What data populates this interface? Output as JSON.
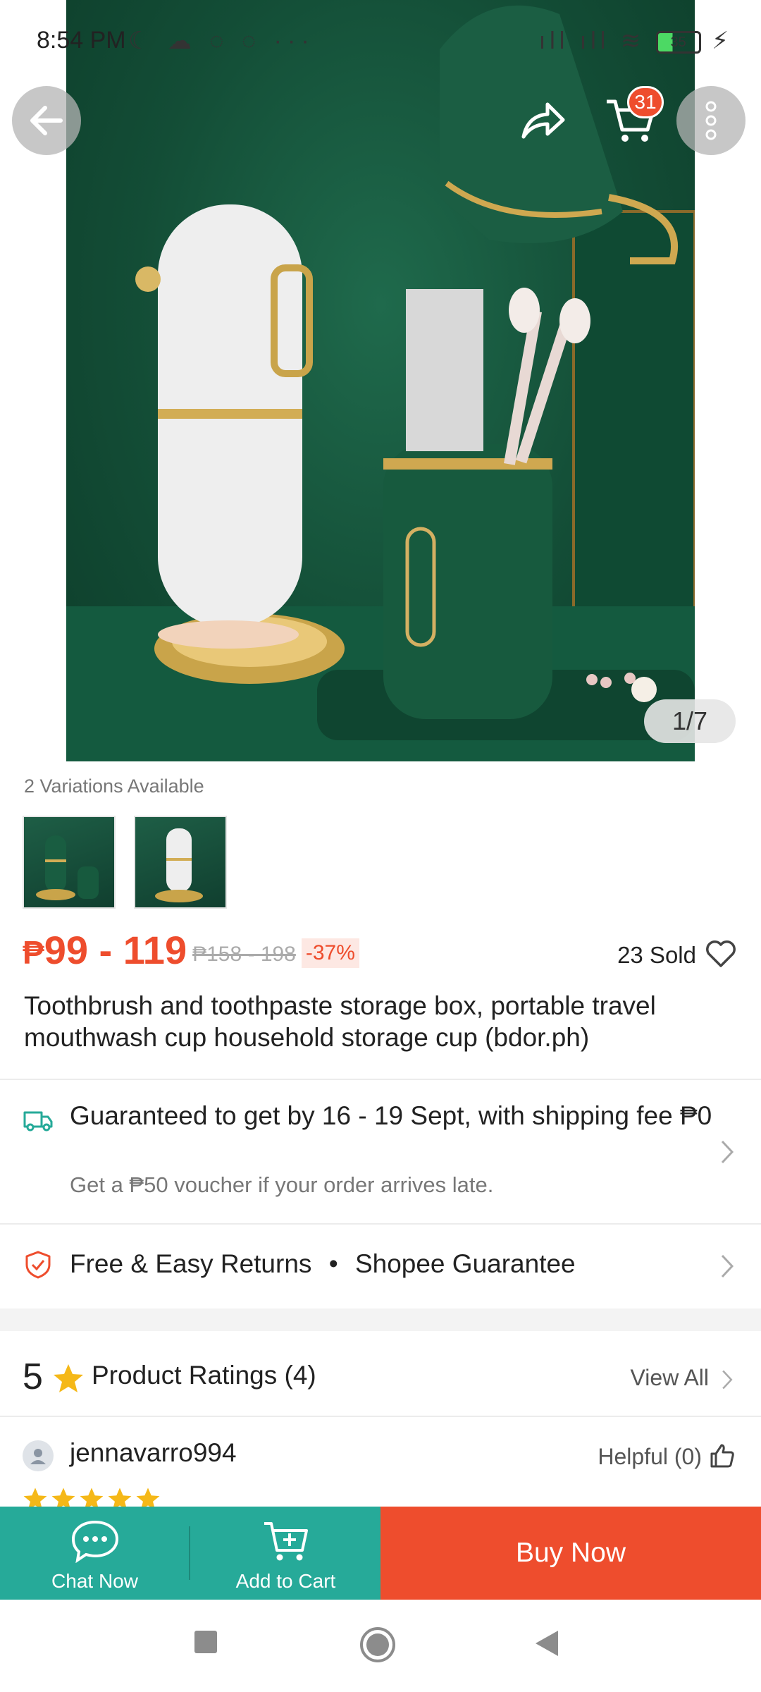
{
  "status_bar": {
    "time": "8:54 PM",
    "left_icons": "☾ ☁ ◌ ◌ ···",
    "right_icons": "ıll ıll ≋",
    "battery": "35"
  },
  "header": {
    "cart_count": "31"
  },
  "gallery": {
    "counter": "1/7"
  },
  "variations": {
    "label": "2 Variations Available"
  },
  "price": {
    "currency": "₱",
    "range": "99 - 119",
    "original": "₱158 - 198",
    "discount": "-37%",
    "sold": "23 Sold"
  },
  "product": {
    "title": "Toothbrush and toothpaste storage box, portable travel mouthwash cup household storage cup (bdor.ph)"
  },
  "shipping": {
    "text": "Guaranteed to get by 16 - 19 Sept, with shipping fee ₱0",
    "sub": "Get a ₱50 voucher if your order arrives late."
  },
  "returns": {
    "text": "Free & Easy Returns",
    "separator": "•",
    "guarantee": "Shopee Guarantee"
  },
  "ratings": {
    "score": "5",
    "label": "Product Ratings",
    "count": "(4)",
    "view_all": "View All"
  },
  "review": {
    "username": "jennavarro994",
    "helpful": "Helpful (0)"
  },
  "action_bar": {
    "chat_label": "Chat Now",
    "cart_label": "Add to Cart",
    "buy_label": "Buy Now"
  },
  "colors": {
    "brand_orange": "#ee4d2d",
    "teal": "#26aa99",
    "star": "#f5b818"
  }
}
